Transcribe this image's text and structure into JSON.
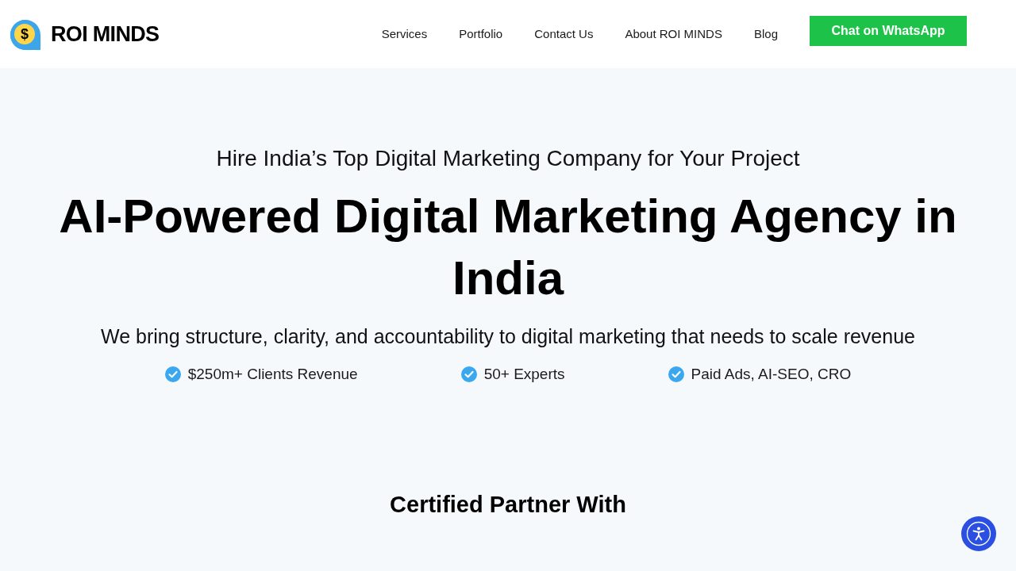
{
  "header": {
    "logo": {
      "symbol": "$",
      "text": "ROI MINDS"
    },
    "nav": [
      "Services",
      "Portfolio",
      "Contact Us",
      "About ROI MINDS",
      "Blog"
    ],
    "cta": "Chat on WhatsApp"
  },
  "hero": {
    "eyebrow": "Hire India’s Top Digital Marketing Company for Your Project",
    "title": "AI-Powered Digital Marketing Agency in India",
    "subtitle": "We bring structure, clarity, and accountability to digital marketing that needs to scale revenue",
    "highlights": [
      "$250m+ Clients Revenue",
      "50+ Experts",
      "Paid Ads, AI-SEO, CRO"
    ]
  },
  "partners": {
    "heading": "Certified Partner With"
  }
}
